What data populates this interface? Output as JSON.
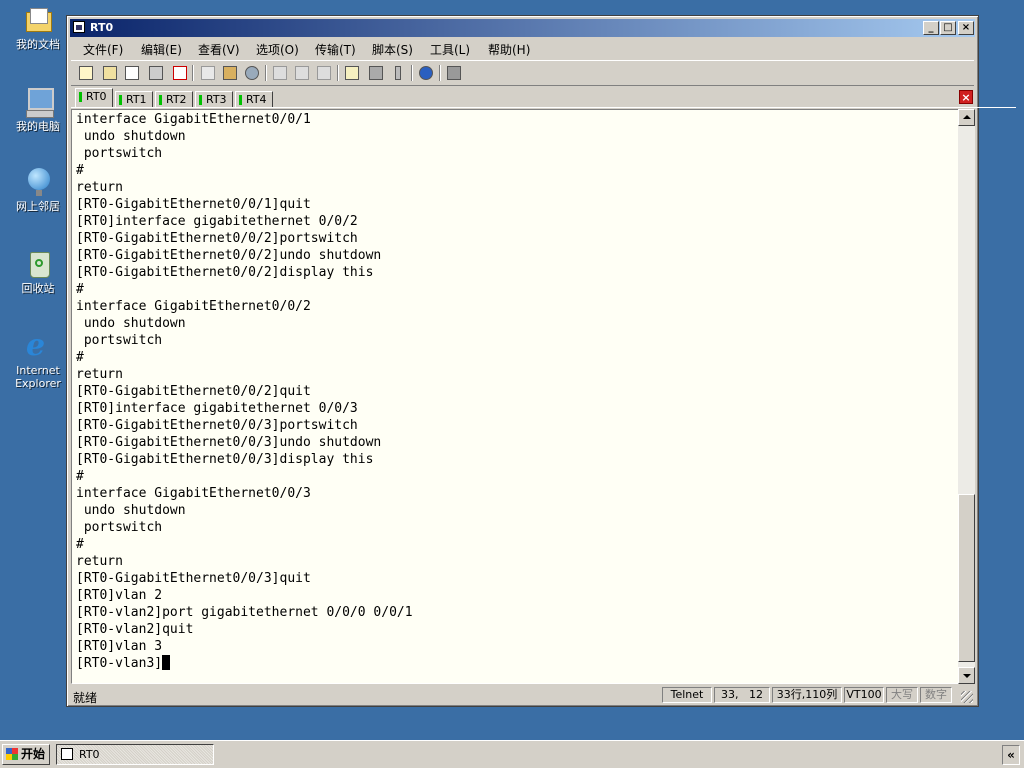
{
  "desktop": {
    "icons": [
      {
        "label": "我的文档",
        "icon": "folder-icon"
      },
      {
        "label": "我的电脑",
        "icon": "computer-icon"
      },
      {
        "label": "网上邻居",
        "icon": "network-icon"
      },
      {
        "label": "回收站",
        "icon": "recycle-bin-icon"
      },
      {
        "label_line1": "Internet",
        "label_line2": "Explorer",
        "icon": "internet-explorer-icon"
      }
    ]
  },
  "window": {
    "title": "RT0",
    "controls": {
      "minimize": "_",
      "maximize": "□",
      "close": "×"
    }
  },
  "menu": [
    "文件(F)",
    "编辑(E)",
    "查看(V)",
    "选项(O)",
    "传输(T)",
    "脚本(S)",
    "工具(L)",
    "帮助(H)"
  ],
  "toolbar": {
    "icons": [
      "new-session-icon",
      "open-session-icon",
      "quick-connect-icon",
      "reconnect-icon",
      "disconnect-icon",
      "copy-icon",
      "paste-icon",
      "find-icon",
      "print-icon",
      "print-setup-icon",
      "print-screen-icon",
      "session-options-icon",
      "global-options-icon",
      "keymap-icon",
      "help-icon",
      "monitor-icon"
    ]
  },
  "tabs": [
    {
      "label": "RT0",
      "active": true
    },
    {
      "label": "RT1",
      "active": false
    },
    {
      "label": "RT2",
      "active": false
    },
    {
      "label": "RT3",
      "active": false
    },
    {
      "label": "RT4",
      "active": false
    }
  ],
  "terminal": {
    "lines": [
      "interface GigabitEthernet0/0/1",
      " undo shutdown",
      " portswitch",
      "#",
      "return",
      "[RT0-GigabitEthernet0/0/1]quit",
      "[RT0]interface gigabitethernet 0/0/2",
      "[RT0-GigabitEthernet0/0/2]portswitch",
      "[RT0-GigabitEthernet0/0/2]undo shutdown",
      "[RT0-GigabitEthernet0/0/2]display this",
      "#",
      "interface GigabitEthernet0/0/2",
      " undo shutdown",
      " portswitch",
      "#",
      "return",
      "[RT0-GigabitEthernet0/0/2]quit",
      "[RT0]interface gigabitethernet 0/0/3",
      "[RT0-GigabitEthernet0/0/3]portswitch",
      "[RT0-GigabitEthernet0/0/3]undo shutdown",
      "[RT0-GigabitEthernet0/0/3]display this",
      "#",
      "interface GigabitEthernet0/0/3",
      " undo shutdown",
      " portswitch",
      "#",
      "return",
      "[RT0-GigabitEthernet0/0/3]quit",
      "[RT0]vlan 2",
      "[RT0-vlan2]port gigabitethernet 0/0/0 0/0/1",
      "[RT0-vlan2]quit",
      "[RT0]vlan 3",
      "[RT0-vlan3]"
    ]
  },
  "status": {
    "ready": "就绪",
    "protocol": "Telnet",
    "position": "33,   12",
    "size": "33行,110列",
    "emulation": "VT100",
    "caps": "大写",
    "num": "数字"
  },
  "taskbar": {
    "start": "开始",
    "task": "RT0",
    "tray": "«"
  }
}
